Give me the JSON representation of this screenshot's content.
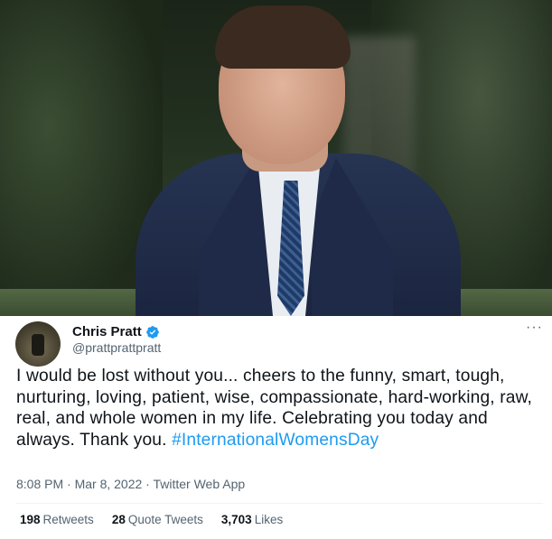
{
  "tweet": {
    "author_name": "Chris Pratt",
    "author_handle": "@prattprattpratt",
    "more_icon": "···",
    "text_main": "I would be lost without you... cheers to the funny, smart, tough, nurturing, loving, patient, wise, compassionate, hard-working, raw, real, and whole women in my life. Celebrating you today and always. Thank you. ",
    "hashtag": "#InternationalWomensDay",
    "timestamp": "8:08 PM · Mar 8, 2022 · Twitter Web App",
    "stats": {
      "retweets_count": "198",
      "retweets_label": "Retweets",
      "quotes_count": "28",
      "quotes_label": "Quote Tweets",
      "likes_count": "3,703",
      "likes_label": "Likes"
    }
  },
  "colors": {
    "link_blue": "#1d9bf0",
    "secondary_text": "#536471",
    "primary_text": "#0f1419"
  },
  "icons": [
    "verified-badge-icon",
    "more-options-icon"
  ]
}
